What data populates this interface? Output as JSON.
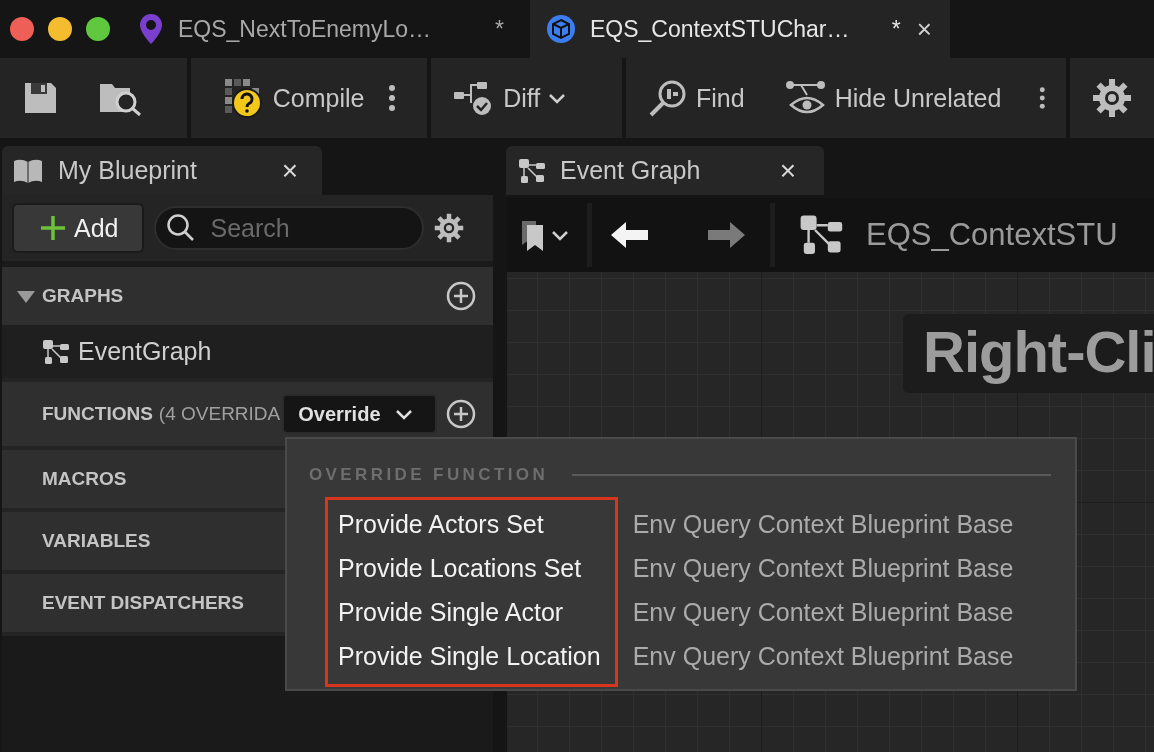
{
  "tabs": [
    {
      "label": "EQS_NextToEnemyLo…",
      "modified": "*",
      "selected": false,
      "kind": "query"
    },
    {
      "label": "EQS_ContextSTUChar…",
      "modified": "*",
      "selected": true,
      "kind": "blueprint",
      "close": "×"
    }
  ],
  "toolbar": [
    {
      "kind": "save"
    },
    {
      "kind": "browse"
    },
    {
      "kind": "compile",
      "label": "Compile",
      "more": true
    },
    {
      "kind": "diff",
      "label": "Diff",
      "dropdown": true
    },
    {
      "kind": "find",
      "label": "Find"
    },
    {
      "kind": "hide",
      "label": "Hide Unrelated",
      "more": true
    },
    {
      "kind": "settings"
    }
  ],
  "my_blueprint": {
    "title": "My Blueprint",
    "close": "×",
    "add_button": "Add",
    "search": {
      "placeholder": "Search"
    },
    "sections": [
      {
        "title": "GRAPHS",
        "expanded": true,
        "add_icon": true,
        "items": [
          {
            "label": "EventGraph"
          }
        ]
      },
      {
        "title": "FUNCTIONS",
        "count": "(4 OVERRIDA",
        "expanded": false,
        "add_icon": true,
        "override_button": "Override"
      },
      {
        "title": "MACROS",
        "expanded": false
      },
      {
        "title": "VARIABLES",
        "expanded": false
      },
      {
        "title": "EVENT DISPATCHERS",
        "expanded": false
      }
    ]
  },
  "graph_panel": {
    "title": "Event Graph",
    "close": "×",
    "breadcrumb": "EQS_ContextSTU",
    "hint": "Right-Cli"
  },
  "override_menu": {
    "heading": "OVERRIDE FUNCTION",
    "highlight_box": true,
    "items": [
      {
        "name": "Provide Actors Set",
        "owner": "Env Query Context Blueprint Base"
      },
      {
        "name": "Provide Locations Set",
        "owner": "Env Query Context Blueprint Base"
      },
      {
        "name": "Provide Single Actor",
        "owner": "Env Query Context Blueprint Base"
      },
      {
        "name": "Provide Single Location",
        "owner": "Env Query Context Blueprint Base"
      }
    ]
  }
}
